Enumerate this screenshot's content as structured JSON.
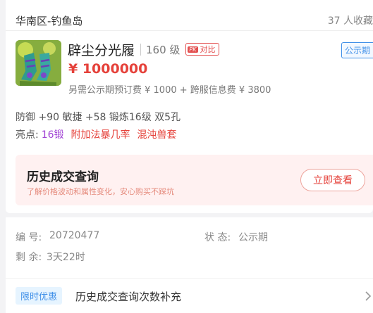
{
  "header": {
    "server": "华南区-钓鱼岛",
    "favorites": "37 人收藏"
  },
  "item": {
    "name": "辟尘分光履",
    "level": "160 级",
    "compare_label": "对比",
    "compare_badge": "PK",
    "status": "公示期",
    "price": "¥ 1000000",
    "fees": "另需公示期预订费 ¥ 1000 + 跨服信息费 ¥ 3800",
    "attributes": "防御 +90 敏捷 +58 锻炼16级 双5孔",
    "highlights_label": "亮点:",
    "highlights": [
      {
        "text": "16锻",
        "color": "#a142d4"
      },
      {
        "text": "附加法暴几率",
        "color": "#e5413a"
      },
      {
        "text": "混沌兽套",
        "color": "#e5413a"
      }
    ]
  },
  "history": {
    "title": "历史成交查询",
    "subtitle": "了解价格波动和属性变化，安心购买不踩坑",
    "button": "立即查看"
  },
  "info": {
    "id_label": "编 号:",
    "id_value": "20720477",
    "status_label": "状 态:",
    "status_value": "公示期",
    "remaining_label": "剩 余:",
    "remaining_value": "3天22时"
  },
  "promo": {
    "tag": "限时优惠",
    "text": "历史成交查询次数补充"
  },
  "icons": {
    "item_image": "green-boots-image",
    "chevron": "chevron-right-icon"
  }
}
